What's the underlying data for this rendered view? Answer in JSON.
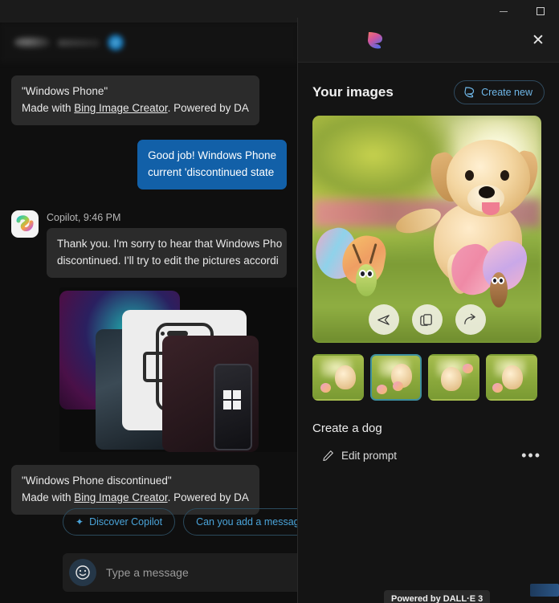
{
  "window": {
    "minimize_label": "Minimize",
    "maximize_label": "Maximize"
  },
  "chat": {
    "messages": [
      {
        "id": "bing-caption-1",
        "line1": "\"Windows Phone\"",
        "line2_prefix": "Made with ",
        "line2_link": "Bing Image Creator",
        "line2_suffix": ". Powered by DA"
      },
      {
        "id": "user-msg",
        "line1": "Good job! Windows Phone",
        "line2": "current 'discontinued state"
      }
    ],
    "copilot": {
      "sender": "Copilot, 9:46 PM",
      "avatar_name": "copilot-logo",
      "reply_line1": "Thank you. I'm sorry to hear that Windows Pho",
      "reply_line2": "discontinued. I'll try to edit the pictures accordi"
    },
    "bing_caption_2": {
      "line1": "\"Windows Phone discontinued\"",
      "line2_prefix": "Made with ",
      "line2_link": "Bing Image Creator",
      "line2_suffix": ". Powered by DA"
    },
    "chips": [
      {
        "label": "Discover Copilot",
        "icon": "sparkle-icon"
      },
      {
        "label": "Can you add a message to",
        "icon": ""
      }
    ],
    "composer": {
      "placeholder": "Type a message",
      "emoji_icon": "smiley-icon"
    }
  },
  "panel": {
    "logo_name": "designer-logo",
    "title": "",
    "close_label": "✕",
    "your_images_title": "Your images",
    "create_new": {
      "label": "Create new",
      "icon": "designer-mark-icon"
    },
    "hero": {
      "alt": "Golden retriever puppy running in sunny park with two cartoon butterflies",
      "actions": [
        {
          "name": "send-icon",
          "glyph": "➤"
        },
        {
          "name": "copy-icon",
          "glyph": "⧉"
        },
        {
          "name": "share-icon",
          "glyph": "↗"
        }
      ]
    },
    "thumbnails": [
      {
        "index": 1,
        "selected": false,
        "alt": "puppy running in grass variant 1"
      },
      {
        "index": 2,
        "selected": true,
        "alt": "puppy with butterflies variant 2"
      },
      {
        "index": 3,
        "selected": false,
        "alt": "puppy in meadow variant 3"
      },
      {
        "index": 4,
        "selected": false,
        "alt": "puppy by pond variant 4"
      }
    ],
    "prompt": "Create a dog",
    "edit_prompt": {
      "label": "Edit prompt",
      "icon": "pencil-icon"
    },
    "more_label": "•••"
  },
  "tooltip": {
    "text": "Powered by DALL·E 3"
  },
  "colors": {
    "accent_blue": "#4aa3d8",
    "user_bubble": "#1260a8",
    "panel_bg": "#141414",
    "selection_ring": "#3d8f9e"
  }
}
